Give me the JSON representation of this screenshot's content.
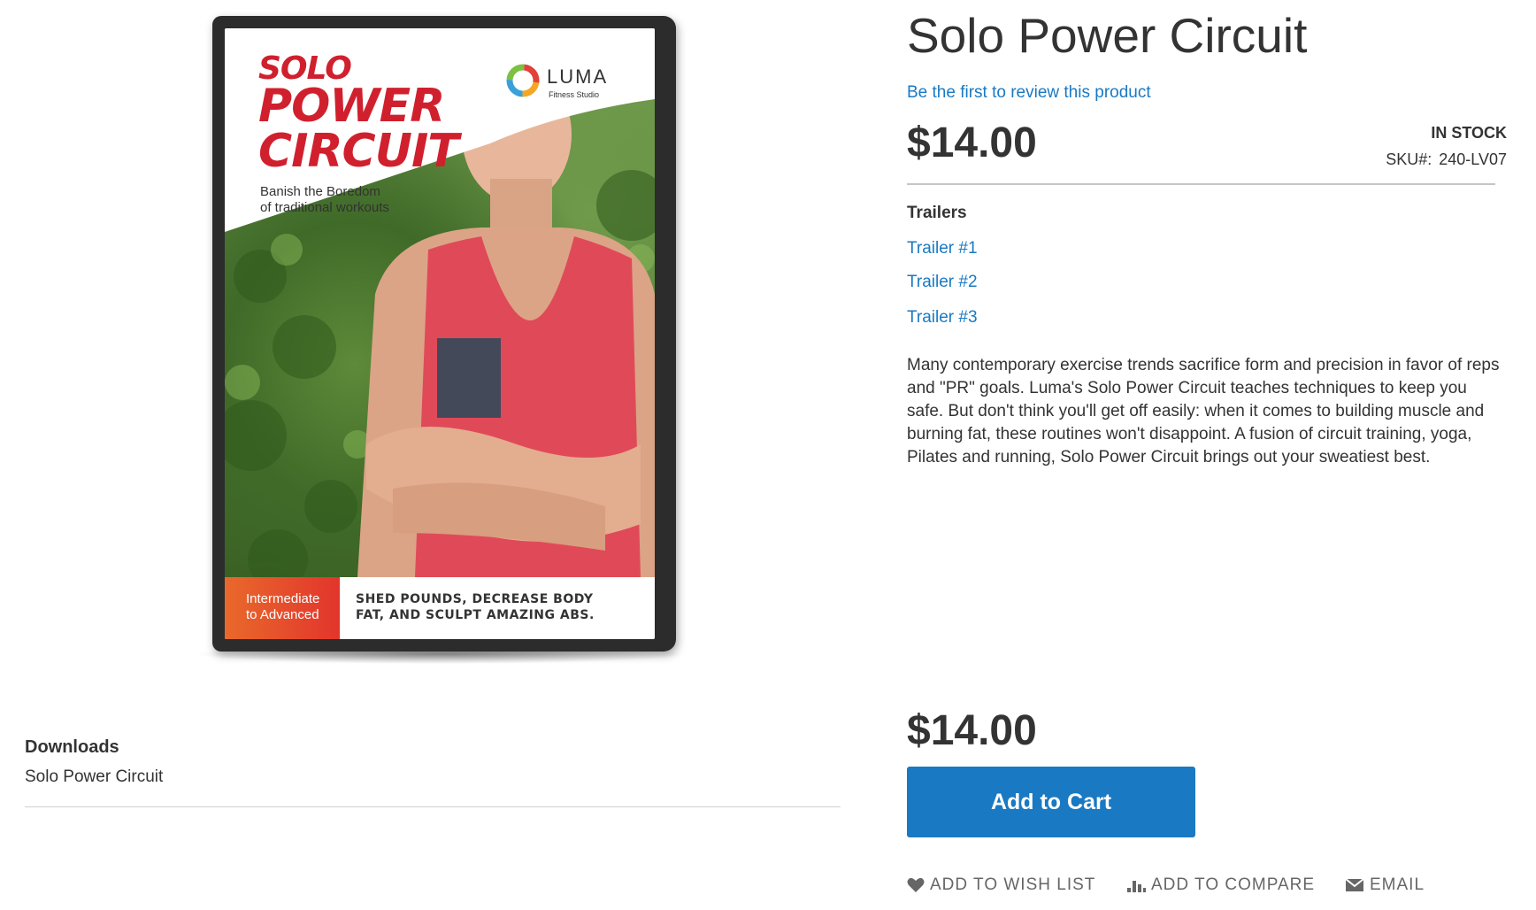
{
  "product": {
    "title": "Solo Power Circuit",
    "review_link": "Be the first to review this product",
    "price": "$14.00",
    "stock": "IN STOCK",
    "sku_label": "SKU#:",
    "sku_value": "240-LV07"
  },
  "cover": {
    "title_line1": "SOLO",
    "title_line2": "POWER",
    "title_line3": "CIRCUIT",
    "tagline_line1": "Banish the Boredom",
    "tagline_line2": "of traditional workouts",
    "logo_word": "LUMA",
    "logo_sub": "Fitness Studio",
    "level_line1": "Intermediate",
    "level_line2": "to Advanced",
    "blurb_line1": "SHED POUNDS, DECREASE BODY",
    "blurb_line2": "FAT, AND SCULPT AMAZING ABS."
  },
  "trailers": {
    "title": "Trailers",
    "items": [
      "Trailer #1",
      "Trailer #2",
      "Trailer #3"
    ]
  },
  "description": "Many contemporary exercise trends sacrifice form and precision in favor of reps and \"PR\" goals. Luma's Solo Power Circuit teaches techniques to keep you safe. But don't think you'll get off easily: when it comes to building muscle and burning fat, these routines won't disappoint. A fusion of circuit training, yoga, Pilates and running, Solo Power Circuit brings out your sweatiest best.",
  "cart": {
    "price": "$14.00",
    "button_label": "Add to Cart"
  },
  "actions": {
    "wishlist": "ADD TO WISH LIST",
    "compare": "ADD TO COMPARE",
    "email": "EMAIL"
  },
  "downloads": {
    "title": "Downloads",
    "item": "Solo Power Circuit"
  },
  "icons": {
    "wishlist": "heart-icon",
    "compare": "bar-chart-icon",
    "email": "envelope-icon"
  },
  "colors": {
    "link": "#1979c3",
    "button": "#1979c3",
    "cover_red": "#d0202e"
  }
}
